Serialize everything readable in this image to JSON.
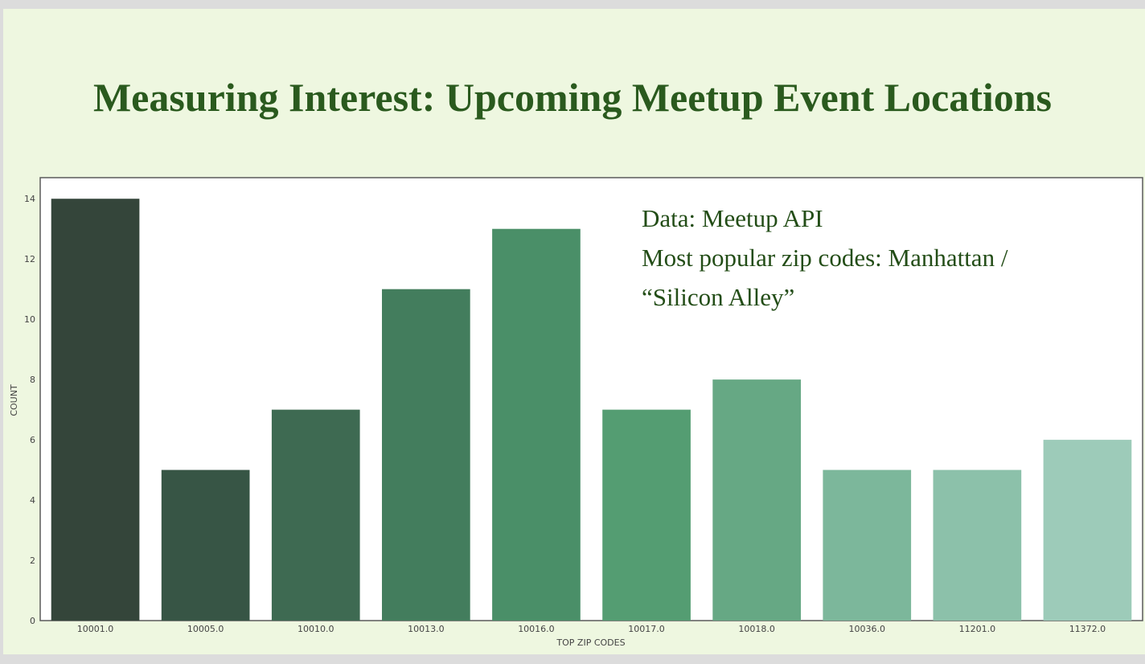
{
  "slide": {
    "title": "Measuring Interest: Upcoming Meetup Event Locations"
  },
  "chart_data": {
    "type": "bar",
    "categories": [
      "10001.0",
      "10005.0",
      "10010.0",
      "10013.0",
      "10016.0",
      "10017.0",
      "10018.0",
      "10036.0",
      "11201.0",
      "11372.0"
    ],
    "values": [
      14,
      5,
      7,
      11,
      13,
      7,
      8,
      5,
      5,
      6
    ],
    "title": "",
    "xlabel": "TOP ZIP CODES",
    "ylabel": "COUNT",
    "ylim": [
      0,
      14.7
    ],
    "yticks": [
      0,
      2,
      4,
      6,
      8,
      10,
      12,
      14
    ],
    "grid": false,
    "legend": "none",
    "bar_colors": [
      "#34453a",
      "#375545",
      "#3e6a52",
      "#437d5d",
      "#4a8f68",
      "#549d72",
      "#66a884",
      "#7cb79b",
      "#8cc1aa",
      "#9dcbb9"
    ],
    "annotation": {
      "lines": [
        "Data: Meetup API",
        "Most popular zip codes: Manhattan /",
        "“Silicon Alley”"
      ]
    }
  }
}
